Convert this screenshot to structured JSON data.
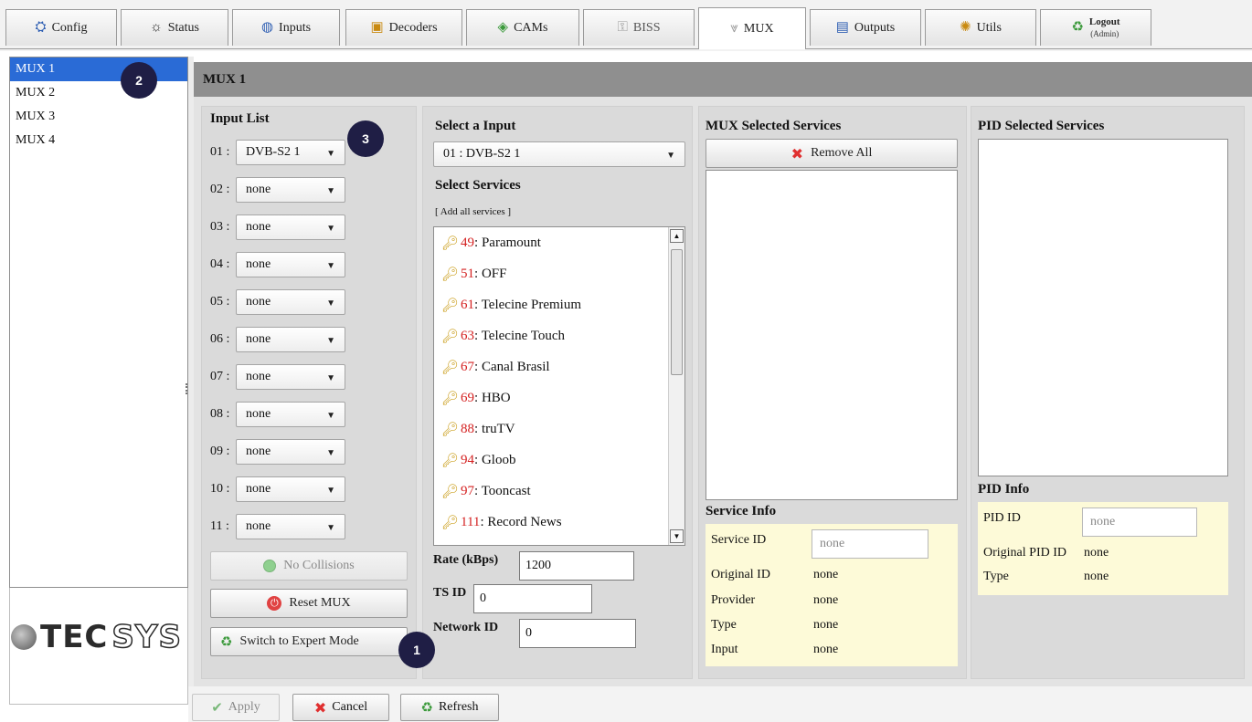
{
  "tabs": [
    {
      "label": "Config",
      "icon": "config-icon",
      "glyph": "⛭"
    },
    {
      "label": "Status",
      "icon": "lightbulb-icon",
      "glyph": "☼"
    },
    {
      "label": "Inputs",
      "icon": "satellite-dish-icon",
      "glyph": "◍"
    },
    {
      "label": "Decoders",
      "icon": "decoder-box-icon",
      "glyph": "▣"
    },
    {
      "label": "CAMs",
      "icon": "cam-card-icon",
      "glyph": "◈"
    },
    {
      "label": "BISS",
      "icon": "key-icon",
      "glyph": "⚿"
    },
    {
      "label": "MUX",
      "icon": "mux-icon",
      "glyph": "⩔"
    },
    {
      "label": "Outputs",
      "icon": "outputs-icon",
      "glyph": "▤"
    },
    {
      "label": "Utils",
      "icon": "utils-icon",
      "glyph": "✺"
    },
    {
      "label": "Logout",
      "sublabel": "(Admin)",
      "icon": "logout-icon",
      "glyph": "♻"
    }
  ],
  "active_tab": "MUX",
  "mux_list": [
    "MUX 1",
    "MUX 2",
    "MUX 3",
    "MUX 4"
  ],
  "selected_mux": "MUX 1",
  "logo": {
    "text_a": "TEC",
    "text_b": "SYS"
  },
  "panel_title": "MUX 1",
  "input_list": {
    "title": "Input List",
    "rows": [
      {
        "num": "01 :",
        "value": "DVB-S2 1"
      },
      {
        "num": "02 :",
        "value": "none"
      },
      {
        "num": "03 :",
        "value": "none"
      },
      {
        "num": "04 :",
        "value": "none"
      },
      {
        "num": "05 :",
        "value": "none"
      },
      {
        "num": "06 :",
        "value": "none"
      },
      {
        "num": "07 :",
        "value": "none"
      },
      {
        "num": "08 :",
        "value": "none"
      },
      {
        "num": "09 :",
        "value": "none"
      },
      {
        "num": "10 :",
        "value": "none"
      },
      {
        "num": "11 :",
        "value": "none"
      }
    ],
    "no_collisions_label": "No Collisions",
    "reset_label": "Reset MUX",
    "expert_label": "Switch to Expert Mode"
  },
  "select_input": {
    "title": "Select a Input",
    "value": "01 : DVB-S2 1",
    "services_title": "Select Services",
    "add_all": "[ Add all services ]",
    "services": [
      {
        "id": "49",
        "name": " : Paramount"
      },
      {
        "id": "51",
        "name": " : OFF"
      },
      {
        "id": "61",
        "name": " : Telecine Premium"
      },
      {
        "id": "63",
        "name": " : Telecine Touch"
      },
      {
        "id": "67",
        "name": " : Canal Brasil"
      },
      {
        "id": "69",
        "name": " : HBO"
      },
      {
        "id": "88",
        "name": " : truTV"
      },
      {
        "id": "94",
        "name": " : Gloob"
      },
      {
        "id": "97",
        "name": " : Tooncast"
      },
      {
        "id": "111",
        "name": " : Record News"
      }
    ],
    "rate_label": "Rate (kBps)",
    "rate_value": "1200",
    "tsid_label": "TS ID",
    "tsid_value": "0",
    "network_label": "Network ID",
    "network_value": "0"
  },
  "mux_selected": {
    "title": "MUX Selected Services",
    "remove_all": "Remove All"
  },
  "service_info": {
    "title": "Service Info",
    "service_id_label": "Service ID",
    "service_id_placeholder": "none",
    "original_id_label": "Original ID",
    "original_id_value": "none",
    "provider_label": "Provider",
    "provider_value": "none",
    "type_label": "Type",
    "type_value": "none",
    "input_label": "Input",
    "input_value": "none"
  },
  "pid_selected": {
    "title": "PID Selected Services"
  },
  "pid_info": {
    "title": "PID Info",
    "pid_id_label": "PID ID",
    "pid_id_placeholder": "none",
    "original_pid_label": "Original PID ID",
    "original_pid_value": "none",
    "type_label": "Type",
    "type_value": "none"
  },
  "footer": {
    "apply": "Apply",
    "cancel": "Cancel",
    "refresh": "Refresh"
  },
  "markers": [
    "1",
    "2",
    "3"
  ],
  "colors": {
    "selection": "#2a6bd6",
    "service_id": "#d42020",
    "marker": "#1f1e45",
    "info_bg": "#fdfad8"
  }
}
